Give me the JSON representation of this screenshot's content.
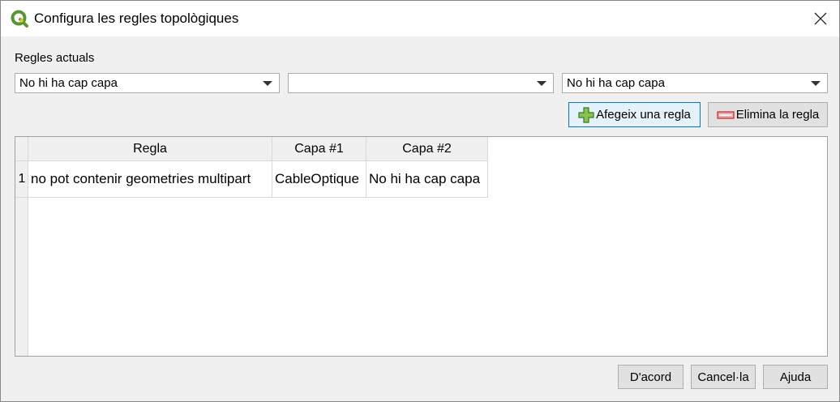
{
  "window": {
    "title": "Configura les regles topològiques"
  },
  "icons": {
    "app": "qgis-logo-icon",
    "close": "close-icon",
    "add": "green-plus-icon",
    "remove": "red-minus-icon"
  },
  "rules_label": "Regles actuals",
  "combos": [
    {
      "value": "No hi ha cap capa"
    },
    {
      "value": ""
    },
    {
      "value": "No hi ha cap capa"
    }
  ],
  "buttons": {
    "add_rule": "Afegeix una regla",
    "remove_rule": "Elimina la regla",
    "ok": "D'acord",
    "cancel": "Cancel·la",
    "help": "Ajuda"
  },
  "table": {
    "columns": [
      "Regla",
      "Capa #1",
      "Capa #2"
    ],
    "rows": [
      {
        "num": "1",
        "cells": [
          "no pot contenir geometries multipart",
          "CableOptique",
          "No hi ha cap capa"
        ]
      }
    ]
  },
  "colors": {
    "accent": "#0078d7",
    "qgis_green": "#589632",
    "qgis_yellow": "#eec90d",
    "add_green": "#4caf50",
    "remove_red": "#e0575b"
  }
}
